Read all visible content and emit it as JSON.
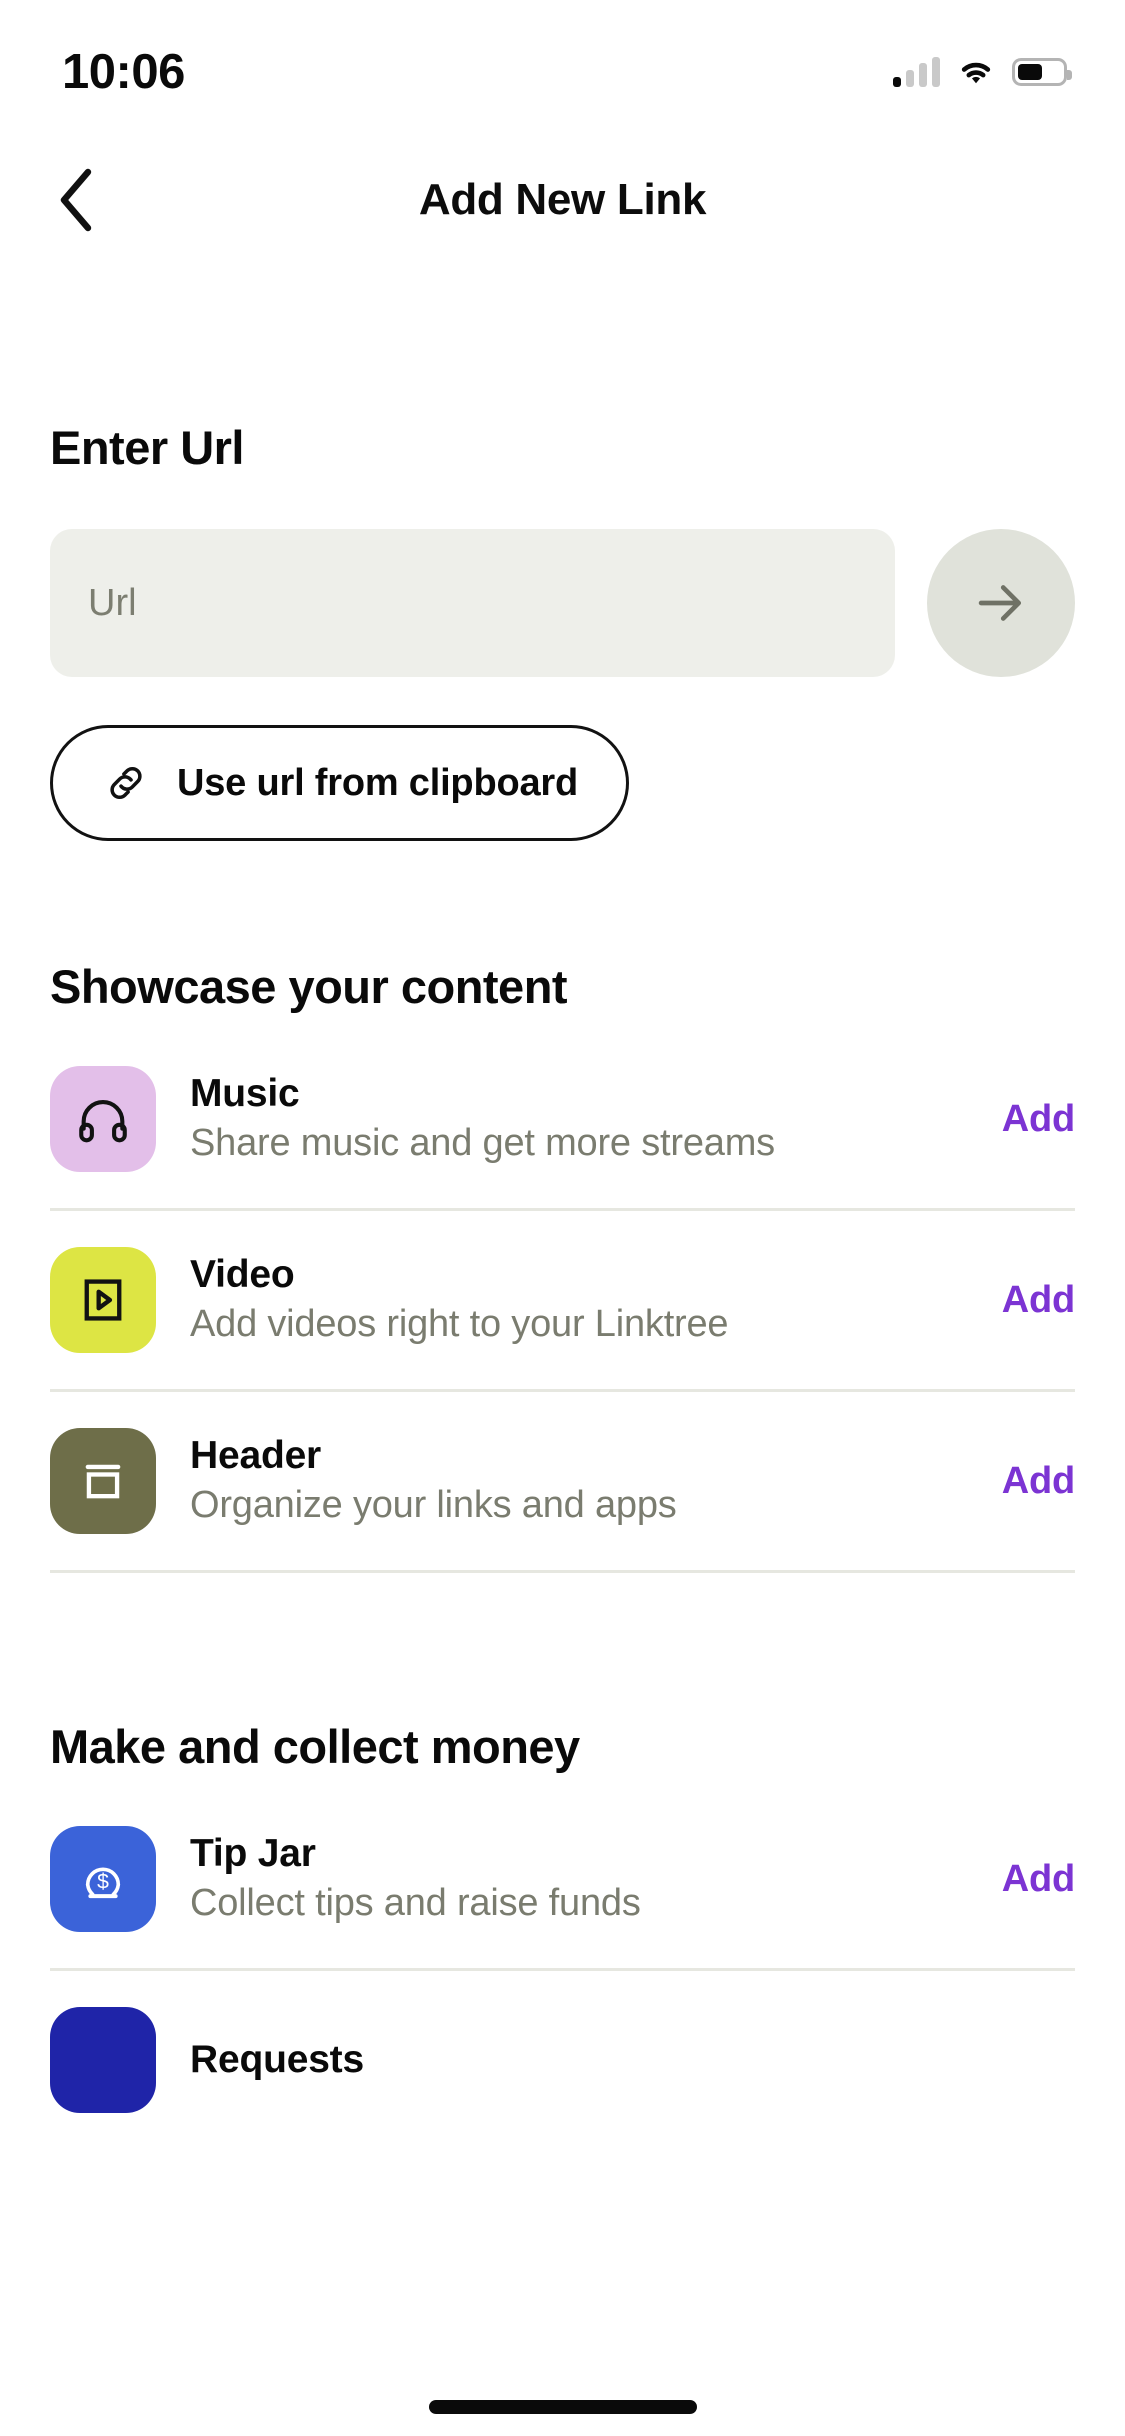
{
  "status_bar": {
    "time": "10:06",
    "cellular_icon": "cellular-signal-icon",
    "wifi_icon": "wifi-icon",
    "battery_icon": "battery-icon",
    "battery_level_percent": 55
  },
  "nav": {
    "back_icon": "chevron-left-icon",
    "title": "Add New Link"
  },
  "url_section": {
    "heading": "Enter Url",
    "input_value": "",
    "input_placeholder": "Url",
    "submit_icon": "arrow-right-icon",
    "clipboard_button": {
      "label": "Use url from clipboard",
      "icon": "link-chain-icon"
    }
  },
  "groups": [
    {
      "title": "Showcase your content",
      "items": [
        {
          "title": "Music",
          "description": "Share music and get more streams",
          "action": "Add",
          "icon": "headphones-icon",
          "icon_bg": "#e3bfe9",
          "icon_fg": "#121212"
        },
        {
          "title": "Video",
          "description": "Add videos right to your Linktree",
          "action": "Add",
          "icon": "video-play-icon",
          "icon_bg": "#dde544",
          "icon_fg": "#121212"
        },
        {
          "title": "Header",
          "description": "Organize your links and apps",
          "action": "Add",
          "icon": "header-card-icon",
          "icon_bg": "#6e6e49",
          "icon_fg": "#ffffff"
        }
      ]
    },
    {
      "title": "Make and collect money",
      "items": [
        {
          "title": "Tip Jar",
          "description": "Collect tips and raise funds",
          "action": "Add",
          "icon": "tip-jar-dollar-icon",
          "icon_bg": "#3b63d9",
          "icon_fg": "#ffffff"
        },
        {
          "title": "Requests",
          "description": "",
          "action": "",
          "icon": "requests-icon",
          "icon_bg": "#1f24a8",
          "icon_fg": "#ffffff"
        }
      ]
    }
  ],
  "colors": {
    "accent_purple": "#7c34d3",
    "field_bg": "#eeefea",
    "field_button_bg": "#e0e2da",
    "muted_text": "#7a7c6f",
    "divider": "#e6e7e0"
  },
  "home_indicator": "home-indicator"
}
